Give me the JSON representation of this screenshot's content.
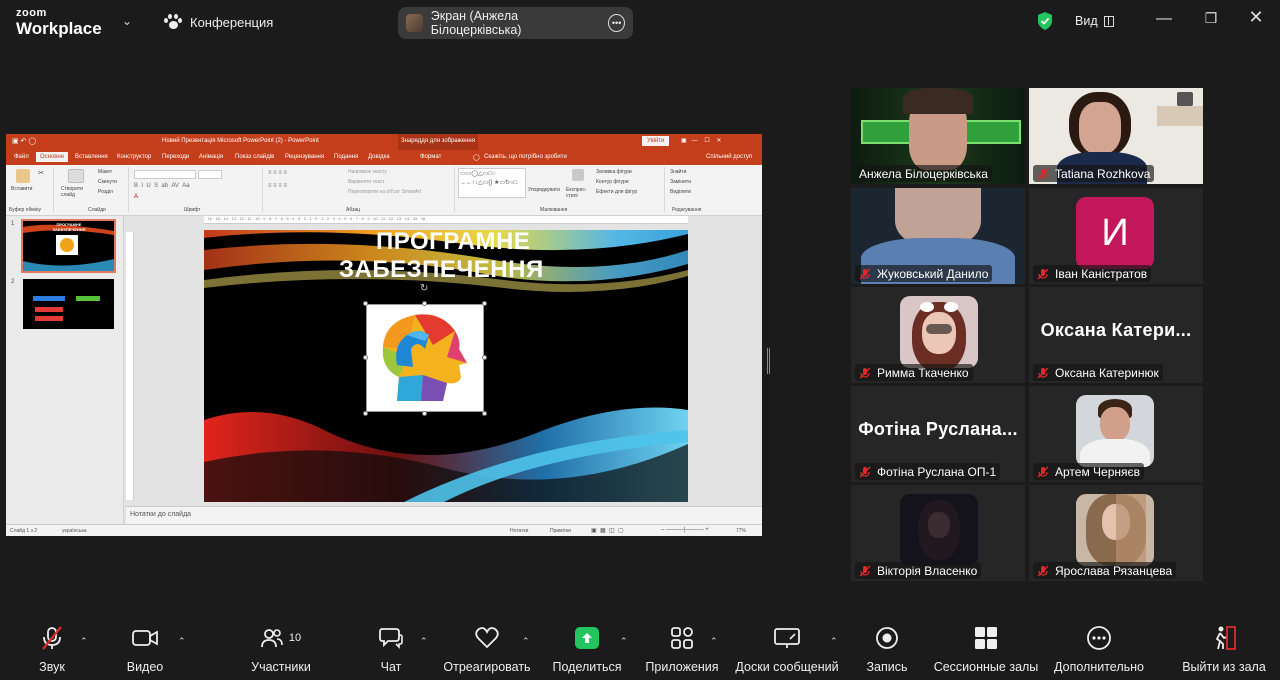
{
  "app": {
    "logo_top": "zoom",
    "logo_bottom": "Workplace",
    "meeting_label": "Конференция",
    "share_label": "Экран (Анжела Білоцерківська)",
    "view_label": "Вид",
    "accent_green": "#3dd47a",
    "share_green": "#23c55e"
  },
  "powerpoint": {
    "window_title": "Новий Презентація Microsoft PowerPoint (2)  -  PowerPoint",
    "context_title": "Знаряддя для зображення",
    "signin": "Увійти",
    "tabs": [
      "Файл",
      "Основне",
      "Вставлення",
      "Конструктор",
      "Переходи",
      "Анімація",
      "Показ слайдів",
      "Рецензування",
      "Подання",
      "Довідка",
      "Формат"
    ],
    "tell_me": "Скажіть, що потрібно зробити",
    "share": "Спільний доступ",
    "ribbon": {
      "paste": "Вставити",
      "new_slide": "Створити слайд",
      "layout": "Макет",
      "reset": "Скинути",
      "section": "Розділ",
      "text_dir": "Напрямок тексту",
      "align_text": "Вирівняти текст",
      "smartart": "Перетворити на об'єкт SmartArt",
      "arrange": "Упорядкувати",
      "quick_styles": "Експрес-стилі",
      "shape_fill": "Заливка фігури",
      "shape_outline": "Контур фігури",
      "shape_effects": "Ефекти для фігур",
      "find": "Знайти",
      "replace": "Замінити",
      "select": "Виділити",
      "groups": [
        "Буфер обміну",
        "Слайди",
        "Шрифт",
        "Абзац",
        "Малювання",
        "Редагування"
      ]
    },
    "slide_title_1": "ПРОГРАМНЕ",
    "slide_title_2": "ЗАБЕЗПЕЧЕННЯ",
    "thumb1_title": "ПРОГРАМНЕ ЗАБЕЗПЕЧЕННЯ",
    "thumb_numbers": [
      "1",
      "2"
    ],
    "notes": "Нотатки до слайда",
    "status": {
      "slide": "Слайд 1 з 2",
      "lang": "українська",
      "notes": "Нотатки",
      "comments": "Примітки",
      "zoom": "77%"
    }
  },
  "participants": [
    {
      "name": "Анжела Білоцерківська",
      "muted": false,
      "active": true,
      "kind": "video"
    },
    {
      "name": "Tatiana Rozhkova",
      "muted": true,
      "active": false,
      "kind": "video"
    },
    {
      "name": "Жуковський Данило",
      "muted": true,
      "active": false,
      "kind": "video"
    },
    {
      "name": "Іван Каністратов",
      "muted": true,
      "active": false,
      "kind": "avatar",
      "avatar_letter": "И",
      "avatar_color": "#c2185b"
    },
    {
      "name": "Римма Ткаченко",
      "muted": true,
      "active": false,
      "kind": "photo"
    },
    {
      "name": "Оксана Катеринюк",
      "muted": true,
      "active": false,
      "kind": "text",
      "big_text": "Оксана  Катери..."
    },
    {
      "name": "Фотіна Руслана ОП-1",
      "muted": true,
      "active": false,
      "kind": "text",
      "big_text": "Фотіна  Руслана..."
    },
    {
      "name": "Артем Черняєв",
      "muted": true,
      "active": false,
      "kind": "photo"
    },
    {
      "name": "Вікторія Власенко",
      "muted": true,
      "active": false,
      "kind": "photo"
    },
    {
      "name": "Ярослава Рязанцева",
      "muted": true,
      "active": false,
      "kind": "photo"
    }
  ],
  "toolbar": {
    "audio": "Звук",
    "video": "Видео",
    "participants": "Участники",
    "participants_count": "10",
    "chat": "Чат",
    "react": "Отреагировать",
    "share": "Поделиться",
    "apps": "Приложения",
    "whiteboards": "Доски сообщений",
    "record": "Запись",
    "breakout": "Сессионные залы",
    "more": "Дополнительно",
    "leave": "Выйти из зала"
  }
}
